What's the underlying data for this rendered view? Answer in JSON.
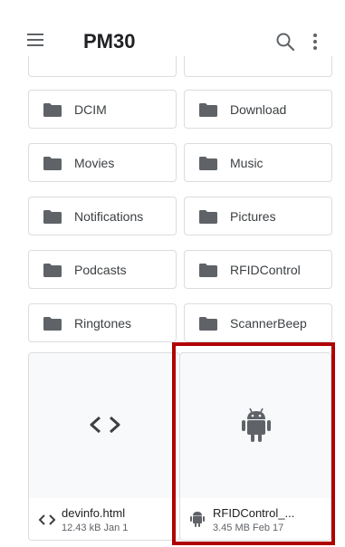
{
  "toolbar": {
    "title": "PM30",
    "menu_icon": "hamburger-menu-icon",
    "search_icon": "search-icon",
    "overflow_icon": "more-vert-icon"
  },
  "folders": [
    {
      "label": "DCIM"
    },
    {
      "label": "Download"
    },
    {
      "label": "Movies"
    },
    {
      "label": "Music"
    },
    {
      "label": "Notifications"
    },
    {
      "label": "Pictures"
    },
    {
      "label": "Podcasts"
    },
    {
      "label": "RFIDControl"
    },
    {
      "label": "Ringtones"
    },
    {
      "label": "ScannerBeep"
    }
  ],
  "files": [
    {
      "name": "devinfo.html",
      "meta": "12.43 kB Jan 1",
      "icon": "code-icon"
    },
    {
      "name": "RFIDControl_...",
      "meta": "3.45 MB Feb 17",
      "icon": "android-icon"
    }
  ],
  "colors": {
    "highlight": "#b00000",
    "icon_gray": "#5f6368",
    "folder_icon": "#5f6368"
  }
}
